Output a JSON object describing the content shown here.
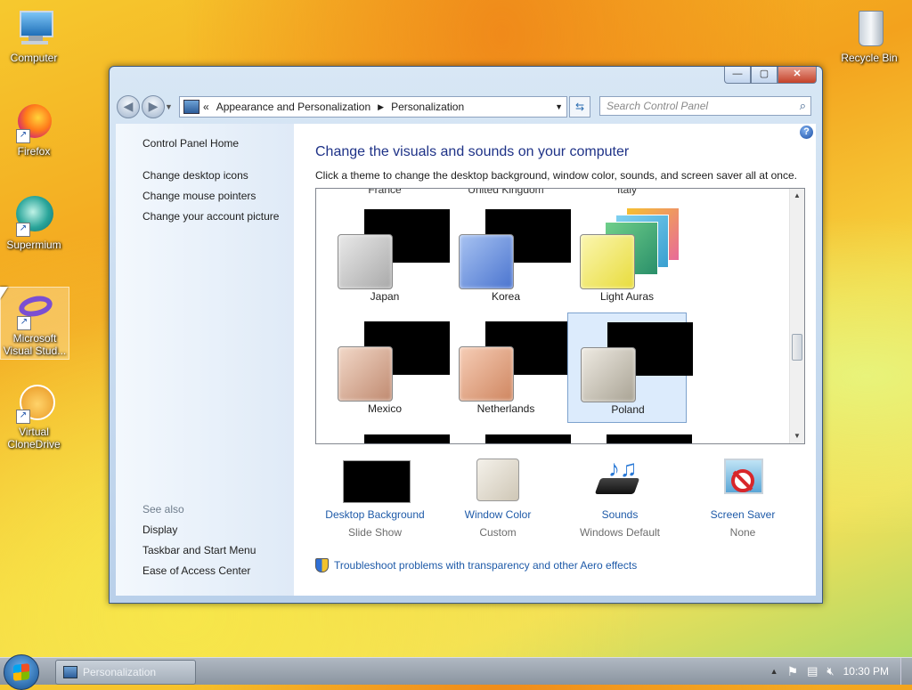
{
  "desktop": {
    "icons": [
      {
        "label": "Computer"
      },
      {
        "label": "Firefox"
      },
      {
        "label": "Supermium"
      },
      {
        "label": "Microsoft Visual Stud..."
      },
      {
        "label": "Virtual CloneDrive"
      },
      {
        "label": "Recycle Bin"
      }
    ]
  },
  "window": {
    "title_buttons": {
      "minimize": "—",
      "maximize": "▢",
      "close": "✕"
    },
    "address": {
      "prefix": "«",
      "crumbs": [
        "Appearance and Personalization",
        "Personalization"
      ],
      "separator": "▶"
    },
    "search": {
      "placeholder": "Search Control Panel"
    },
    "left_pane": {
      "home": "Control Panel Home",
      "links": [
        "Change desktop icons",
        "Change mouse pointers",
        "Change your account picture"
      ],
      "see_also_label": "See also",
      "see_also": [
        "Display",
        "Taskbar and Start Menu",
        "Ease of Access Center"
      ]
    },
    "main": {
      "heading": "Change the visuals and sounds on your computer",
      "subheading": "Click a theme to change the desktop background, window color, sounds, and screen saver all at once.",
      "top_row_partial": [
        "France",
        "United Kingdom",
        "Italy"
      ],
      "themes": [
        {
          "name": "Japan",
          "glass_color": "#c8c8c8"
        },
        {
          "name": "Korea",
          "glass_color": "#6f95de"
        },
        {
          "name": "Light Auras",
          "glass_color": "#f1ea6a"
        },
        {
          "name": "Mexico",
          "glass_color": "#d9ab94"
        },
        {
          "name": "Netherlands",
          "glass_color": "#de9f7f"
        },
        {
          "name": "Poland",
          "glass_color": "#bdb7ab",
          "selected": true
        }
      ],
      "bottom_items": [
        {
          "title": "Desktop Background",
          "value": "Slide Show",
          "icon": "desktop-background-icon"
        },
        {
          "title": "Window Color",
          "value": "Custom",
          "icon": "window-color-icon"
        },
        {
          "title": "Sounds",
          "value": "Windows Default",
          "icon": "sounds-icon"
        },
        {
          "title": "Screen Saver",
          "value": "None",
          "icon": "screen-saver-icon"
        }
      ],
      "troubleshoot": "Troubleshoot problems with transparency and other Aero effects"
    }
  },
  "taskbar": {
    "task_label": "Personalization",
    "tray_up": "▲",
    "clock": "10:30 PM"
  }
}
